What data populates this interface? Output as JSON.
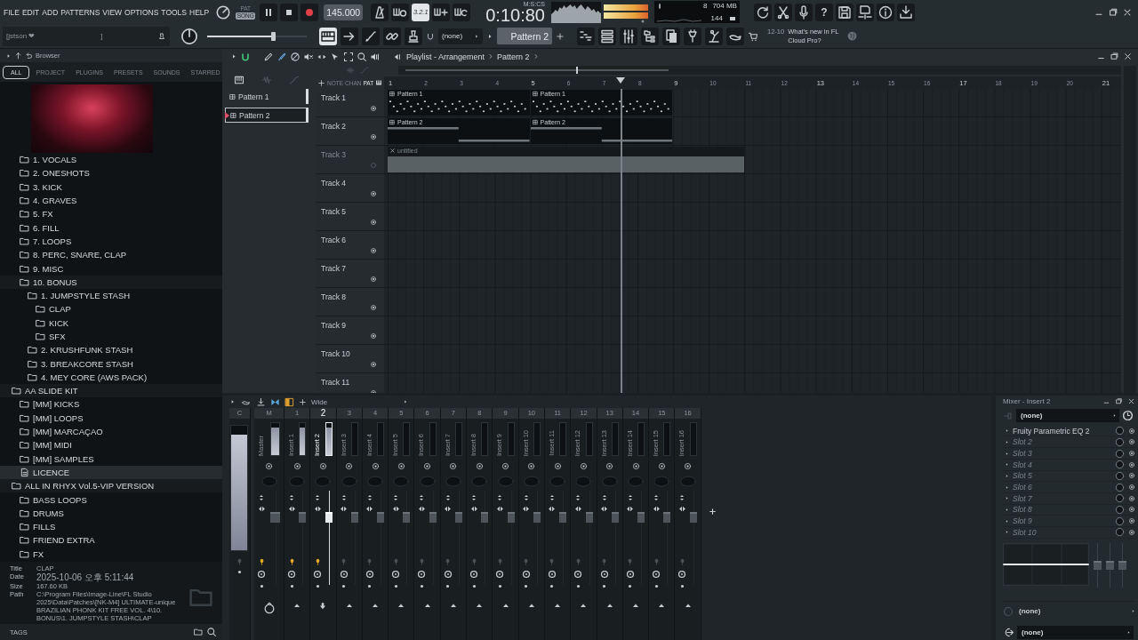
{
  "menu": [
    "FILE",
    "EDIT",
    "ADD",
    "PATTERNS",
    "VIEW",
    "OPTIONS",
    "TOOLS",
    "HELP"
  ],
  "transport": {
    "modes": [
      {
        "label": "PAT",
        "selected": false
      },
      {
        "label": "SONG",
        "selected": true
      }
    ],
    "playing": true,
    "tempo": "145.000",
    "countdown": {
      "label": "3.2.1",
      "on": true
    },
    "time": "0:10:80",
    "time_unit": "M:S:CS"
  },
  "monitor": {
    "cpu": "8",
    "memory": "704 MB",
    "polyphony": "144"
  },
  "toolbar": {
    "help": "?",
    "keyboard_on": true
  },
  "hint": {
    "text": "[jstson ❤",
    "suffix": "]"
  },
  "volume": {
    "level": 0.66
  },
  "snap": "(none)",
  "pattern": "Pattern 2",
  "news": {
    "date": "12-10",
    "headline": "What's new in FL Cloud Pro?"
  },
  "browser": {
    "title": "Browser",
    "tabs": [
      {
        "label": "ALL",
        "selected": true
      },
      {
        "label": "PROJECT",
        "selected": false
      },
      {
        "label": "PLUGINS",
        "selected": false
      },
      {
        "label": "PRESETS",
        "selected": false
      },
      {
        "label": "SOUNDS",
        "selected": false
      },
      {
        "label": "STARRED",
        "selected": false
      }
    ],
    "tree": [
      {
        "kind": "cover",
        "children": [
          {
            "label": "1. VOCALS",
            "kind": "folder",
            "selected": false
          },
          {
            "label": "2. ONESHOTS",
            "kind": "folder",
            "selected": false
          },
          {
            "label": "3. KICK",
            "kind": "folder",
            "selected": false
          },
          {
            "label": "4. GRAVES",
            "kind": "folder",
            "selected": false
          },
          {
            "label": "5. FX",
            "kind": "folder",
            "selected": false
          },
          {
            "label": "6. FILL",
            "kind": "folder",
            "selected": false
          },
          {
            "label": "7. LOOPS",
            "kind": "folder",
            "selected": false
          },
          {
            "label": "8. PERC, SNARE, CLAP",
            "kind": "folder",
            "selected": false
          },
          {
            "label": "9. MISC",
            "kind": "folder",
            "selected": false
          },
          {
            "label": "10. BONUS",
            "kind": "folder",
            "selected": false,
            "children": [
              {
                "label": "1. JUMPSTYLE STASH",
                "kind": "folder",
                "selected": false,
                "children": [
                  {
                    "label": "CLAP",
                    "kind": "folder",
                    "selected": false
                  },
                  {
                    "label": "KICK",
                    "kind": "folder",
                    "selected": false
                  },
                  {
                    "label": "SFX",
                    "kind": "folder",
                    "selected": false
                  }
                ]
              },
              {
                "label": "2. KRUSHFUNK STASH",
                "kind": "folder",
                "selected": false
              },
              {
                "label": "3. BREAKCORE STASH",
                "kind": "folder",
                "selected": false
              },
              {
                "label": "4. MEY CORE (AWS PACK)",
                "kind": "folder",
                "selected": false
              }
            ]
          }
        ]
      },
      {
        "label": "AA SLIDE KIT",
        "kind": "folder",
        "selected": false,
        "children": [
          {
            "label": "[MM] KICKS",
            "kind": "folder",
            "selected": false
          },
          {
            "label": "[MM] LOOPS",
            "kind": "folder",
            "selected": false
          },
          {
            "label": "[MM] MARCAÇAO",
            "kind": "folder",
            "selected": false
          },
          {
            "label": "[MM] MIDI",
            "kind": "folder",
            "selected": false
          },
          {
            "label": "[MM] SAMPLES",
            "kind": "folder",
            "selected": false
          },
          {
            "label": "LICENCE",
            "kind": "text",
            "selected": true
          }
        ]
      },
      {
        "label": "ALL IN RHYX Vol.5-VIP VERSION",
        "kind": "folder",
        "selected": false,
        "children": [
          {
            "label": "BASS LOOPS",
            "kind": "folder",
            "selected": false
          },
          {
            "label": "DRUMS",
            "kind": "folder",
            "selected": false
          },
          {
            "label": "FILLS",
            "kind": "folder",
            "selected": false
          },
          {
            "label": "FRIEND EXTRA",
            "kind": "folder",
            "selected": false
          },
          {
            "label": "FX",
            "kind": "folder",
            "selected": false
          }
        ]
      }
    ],
    "info": [
      {
        "label": "Title",
        "value": "CLAP"
      },
      {
        "label": "Date",
        "value": "2025-10-06 오후 5:11:44"
      },
      {
        "label": "Size",
        "value": "167.60 KB"
      },
      {
        "label": "Path",
        "value": "C:\\Program Files\\Image-Line\\FL Studio 2025\\Data\\Patches\\[NK-M4] ULTIMATE-unique BRAZILIAN PHONK KIT FREE VOL. 4\\10. BONUS\\1. JUMPSTYLE STASH\\CLAP"
      }
    ],
    "tags": "TAGS"
  },
  "playlist": {
    "title": "Playlist - Arrangement",
    "breadcrumb": "Pattern 2",
    "patterns": [
      {
        "label": "Pattern 1",
        "selected": false
      },
      {
        "label": "Pattern 2",
        "selected": true
      }
    ],
    "filters": [
      {
        "label": "NOTE",
        "selected": false
      },
      {
        "label": "CHAN",
        "selected": false
      },
      {
        "label": "PAT",
        "selected": true
      }
    ],
    "bars": [
      "1",
      "2",
      "3",
      "4",
      "5",
      "6",
      "7",
      "8",
      "9",
      "10",
      "11",
      "12",
      "13",
      "14",
      "15",
      "16",
      "17",
      "18",
      "19",
      "20",
      "21"
    ],
    "tracks": [
      {
        "name": "Track 1",
        "muted": false,
        "clips": [
          {
            "kind": "notes",
            "label": "Pattern 1"
          },
          {
            "kind": "notes",
            "label": "Pattern 1"
          }
        ]
      },
      {
        "name": "Track 2",
        "muted": false,
        "clips": [
          {
            "kind": "bars",
            "label": "Pattern 2"
          },
          {
            "kind": "bars",
            "label": "Pattern 2"
          }
        ]
      },
      {
        "name": "Track 3",
        "muted": true,
        "clips": [
          {
            "kind": "audio",
            "label": "untitled"
          }
        ]
      },
      {
        "name": "Track 4",
        "muted": false
      },
      {
        "name": "Track 5",
        "muted": false
      },
      {
        "name": "Track 6",
        "muted": false
      },
      {
        "name": "Track 7",
        "muted": false
      },
      {
        "name": "Track 8",
        "muted": false
      },
      {
        "name": "Track 9",
        "muted": false
      },
      {
        "name": "Track 10",
        "muted": false
      },
      {
        "name": "Track 11",
        "muted": false
      }
    ]
  },
  "mixer": {
    "preset": "Wide",
    "strips": [
      {
        "kind": "current",
        "number": "C",
        "routed": false,
        "meter": {
          "level": 0.93
        }
      },
      {
        "kind": "master",
        "number": "M",
        "name": "Master",
        "selected": false,
        "routed": true,
        "meter": {
          "level": 0.85
        },
        "fader": {
          "level": 0.75
        }
      },
      {
        "kind": "insert",
        "number": "1",
        "name": "Insert 1",
        "selected": false,
        "routed": true,
        "meter": {
          "level": 0.85
        },
        "fader": {
          "level": 0.75
        }
      },
      {
        "kind": "insert",
        "number": "2",
        "name": "Insert 2",
        "selected": true,
        "routed": true,
        "meter": {
          "level": 0.85
        },
        "fader": {
          "level": 0.75
        }
      },
      {
        "kind": "insert",
        "number": "3",
        "name": "Insert 3",
        "selected": false,
        "routed": false,
        "meter": {
          "level": 0
        },
        "fader": {
          "level": 0.75
        }
      },
      {
        "kind": "insert",
        "number": "4",
        "name": "Insert 4",
        "selected": false,
        "routed": false,
        "meter": {
          "level": 0
        },
        "fader": {
          "level": 0.75
        }
      },
      {
        "kind": "insert",
        "number": "5",
        "name": "Insert 5",
        "selected": false,
        "routed": false,
        "meter": {
          "level": 0
        },
        "fader": {
          "level": 0.75
        }
      },
      {
        "kind": "insert",
        "number": "6",
        "name": "Insert 6",
        "selected": false,
        "routed": false,
        "meter": {
          "level": 0
        },
        "fader": {
          "level": 0.75
        }
      },
      {
        "kind": "insert",
        "number": "7",
        "name": "Insert 7",
        "selected": false,
        "routed": false,
        "meter": {
          "level": 0
        },
        "fader": {
          "level": 0.75
        }
      },
      {
        "kind": "insert",
        "number": "8",
        "name": "Insert 8",
        "selected": false,
        "routed": false,
        "meter": {
          "level": 0
        },
        "fader": {
          "level": 0.75
        }
      },
      {
        "kind": "insert",
        "number": "9",
        "name": "Insert 9",
        "selected": false,
        "routed": false,
        "meter": {
          "level": 0
        },
        "fader": {
          "level": 0.75
        }
      },
      {
        "kind": "insert",
        "number": "10",
        "name": "Insert 10",
        "selected": false,
        "routed": false,
        "meter": {
          "level": 0
        },
        "fader": {
          "level": 0.75
        }
      },
      {
        "kind": "insert",
        "number": "11",
        "name": "Insert 11",
        "selected": false,
        "routed": false,
        "meter": {
          "level": 0
        },
        "fader": {
          "level": 0.75
        }
      },
      {
        "kind": "insert",
        "number": "12",
        "name": "Insert 12",
        "selected": false,
        "routed": false,
        "meter": {
          "level": 0
        },
        "fader": {
          "level": 0.75
        }
      },
      {
        "kind": "insert",
        "number": "13",
        "name": "Insert 13",
        "selected": false,
        "routed": false,
        "meter": {
          "level": 0
        },
        "fader": {
          "level": 0.75
        }
      },
      {
        "kind": "insert",
        "number": "14",
        "name": "Insert 14",
        "selected": false,
        "routed": false,
        "meter": {
          "level": 0
        },
        "fader": {
          "level": 0.75
        }
      },
      {
        "kind": "insert",
        "number": "15",
        "name": "Insert 15",
        "selected": false,
        "routed": false,
        "meter": {
          "level": 0
        },
        "fader": {
          "level": 0.75
        }
      },
      {
        "kind": "insert",
        "number": "16",
        "name": "Insert 16",
        "selected": false,
        "routed": false,
        "meter": {
          "level": 0
        },
        "fader": {
          "level": 0.75
        }
      }
    ]
  },
  "insert_panel": {
    "title": "Mixer - Insert 2",
    "input": "(none)",
    "slots": [
      {
        "name": "Fruity Parametric EQ 2",
        "empty": false
      },
      {
        "name": "Slot 2",
        "empty": true
      },
      {
        "name": "Slot 3",
        "empty": true
      },
      {
        "name": "Slot 4",
        "empty": true
      },
      {
        "name": "Slot 5",
        "empty": true
      },
      {
        "name": "Slot 6",
        "empty": true
      },
      {
        "name": "Slot 7",
        "empty": true
      },
      {
        "name": "Slot 8",
        "empty": true
      },
      {
        "name": "Slot 9",
        "empty": true
      },
      {
        "name": "Slot 10",
        "empty": true
      }
    ],
    "faders": [
      {
        "level": 0.5
      },
      {
        "level": 0.5
      },
      {
        "level": 0.5
      }
    ],
    "sidechain": "(none)",
    "output": "(none)"
  }
}
